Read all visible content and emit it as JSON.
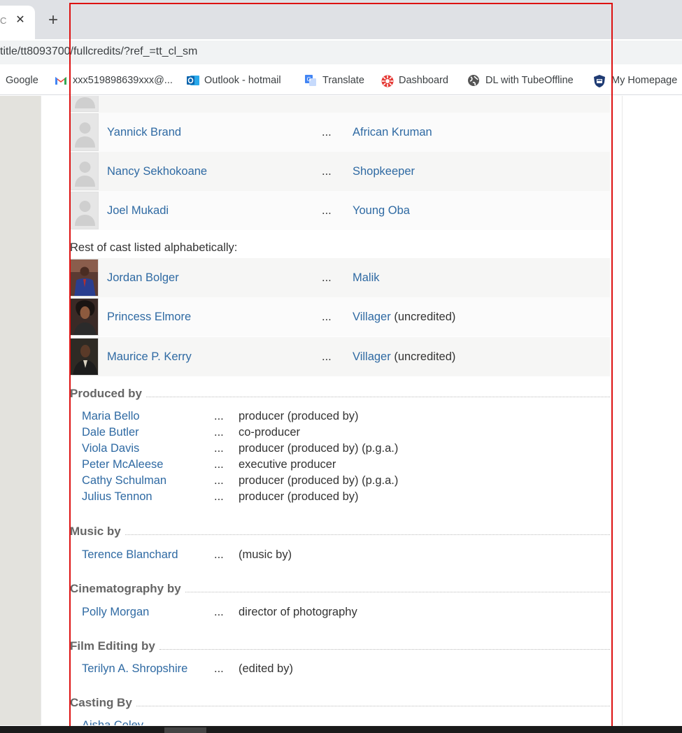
{
  "browser": {
    "tab_title": "Ca",
    "url": "title/tt8093700/fullcredits/?ref_=tt_cl_sm",
    "bookmarks": [
      {
        "label": "Google",
        "icon": "google-icon"
      },
      {
        "label": "xxx519898639xxx@...",
        "icon": "gmail-icon"
      },
      {
        "label": "Outlook - hotmail",
        "icon": "outlook-icon"
      },
      {
        "label": "Translate",
        "icon": "translate-icon"
      },
      {
        "label": "Dashboard",
        "icon": "dashboard-icon"
      },
      {
        "label": "DL with TubeOffline",
        "icon": "globe-icon"
      },
      {
        "label": "My Homepage",
        "icon": "shield-icon"
      }
    ]
  },
  "cast": {
    "rows": [
      {
        "actor": "Yannick Brand",
        "ellipsis": "...",
        "character": "African Kruman",
        "note": ""
      },
      {
        "actor": "Nancy Sekhokoane",
        "ellipsis": "...",
        "character": "Shopkeeper",
        "note": ""
      },
      {
        "actor": "Joel Mukadi",
        "ellipsis": "...",
        "character": "Young Oba",
        "note": ""
      }
    ],
    "rest_label": "Rest of cast listed alphabetically:",
    "rest_rows": [
      {
        "actor": "Jordan Bolger",
        "ellipsis": "...",
        "character": "Malik",
        "note": ""
      },
      {
        "actor": "Princess Elmore",
        "ellipsis": "...",
        "character": "Villager",
        "note": "(uncredited)"
      },
      {
        "actor": "Maurice P. Kerry",
        "ellipsis": "...",
        "character": "Villager",
        "note": "(uncredited)"
      }
    ]
  },
  "sections": [
    {
      "heading": "Produced by",
      "rows": [
        {
          "name": "Maria Bello",
          "dots": "...",
          "credit": "producer (produced by)"
        },
        {
          "name": "Dale Butler",
          "dots": "...",
          "credit": "co-producer"
        },
        {
          "name": "Viola Davis",
          "dots": "...",
          "credit": "producer (produced by) (p.g.a.)"
        },
        {
          "name": "Peter McAleese",
          "dots": "...",
          "credit": "executive producer"
        },
        {
          "name": "Cathy Schulman",
          "dots": "...",
          "credit": "producer (produced by) (p.g.a.)"
        },
        {
          "name": "Julius Tennon",
          "dots": "...",
          "credit": "producer (produced by)"
        }
      ]
    },
    {
      "heading": "Music by",
      "rows": [
        {
          "name": "Terence Blanchard",
          "dots": "...",
          "credit": "(music by)"
        }
      ]
    },
    {
      "heading": "Cinematography by",
      "rows": [
        {
          "name": "Polly Morgan",
          "dots": "...",
          "credit": "director of photography"
        }
      ]
    },
    {
      "heading": "Film Editing by",
      "rows": [
        {
          "name": "Terilyn A. Shropshire",
          "dots": "...",
          "credit": "(edited by)"
        }
      ]
    },
    {
      "heading": "Casting By",
      "rows": [
        {
          "name": "Aisha Coley",
          "dots": "",
          "credit": ""
        }
      ]
    }
  ],
  "colors": {
    "link": "#2f6aa3",
    "highlight_box": "#dd1111"
  }
}
